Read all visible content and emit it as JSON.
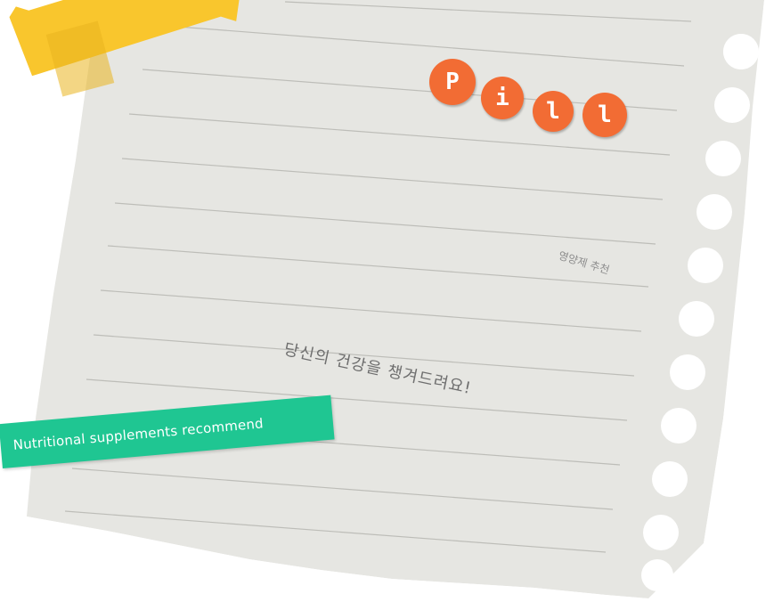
{
  "logo": {
    "letters": [
      "P",
      "i",
      "l",
      "l"
    ]
  },
  "note": {
    "subtitle": "영양제 추천",
    "headline": "당신의 건강을 챙겨드려요!",
    "tag": "Nutritional supplements recommend"
  },
  "colors": {
    "paper": "#e6e6e2",
    "line": "#bdbdb8",
    "tape": "#f9c62d",
    "dot": "#f26c34",
    "tag": "#1fc692"
  }
}
